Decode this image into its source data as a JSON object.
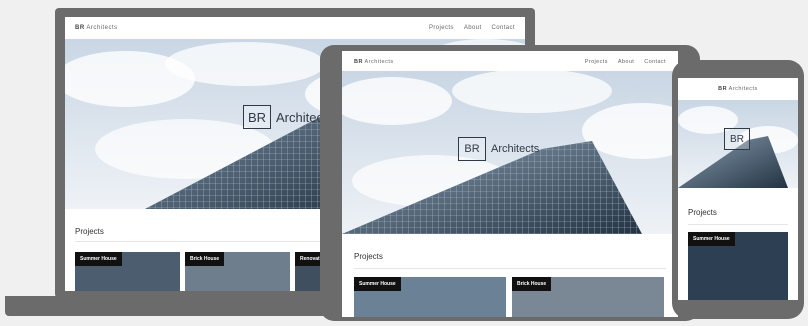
{
  "brand": {
    "initials": "BR",
    "name": "Architects"
  },
  "nav": {
    "items": [
      "Projects",
      "About",
      "Contact"
    ]
  },
  "hero": {
    "logo_initials": "BR",
    "logo_text": "Architects"
  },
  "section": {
    "title": "Projects"
  },
  "cards": [
    "Summer House",
    "Brick House",
    "Renovati"
  ],
  "colors": {
    "device_frame": "#6b6b6b",
    "background": "#f0f0f0",
    "tag": "#111111"
  }
}
